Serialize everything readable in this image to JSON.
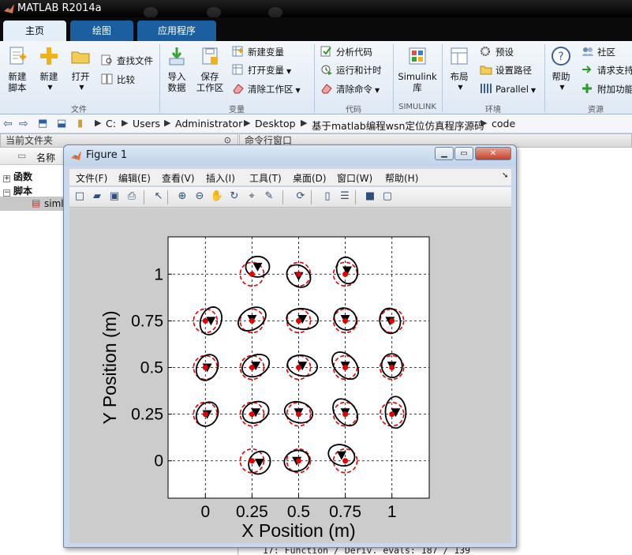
{
  "app": {
    "title": "MATLAB R2014a"
  },
  "tabs": [
    {
      "label": "主页"
    },
    {
      "label": "绘图"
    },
    {
      "label": "应用程序"
    }
  ],
  "ribbon": {
    "file": {
      "new_script": "新建\n脚本",
      "new": "新建",
      "open": "打开",
      "find_files": "查找文件",
      "compare": "比较",
      "group": "文件"
    },
    "variable": {
      "import": "导入\n数据",
      "save_ws": "保存\n工作区",
      "new_var": "新建变量",
      "open_var": "打开变量",
      "clear_ws": "清除工作区",
      "group": "变量"
    },
    "code": {
      "analyze": "分析代码",
      "run_time": "运行和计时",
      "clear_cmd": "清除命令",
      "group": "代码"
    },
    "simulink": {
      "label": "Simulink\n库",
      "group": "SIMULINK"
    },
    "env": {
      "layout": "布局",
      "prefs": "预设",
      "set_path": "设置路径",
      "parallel": "Parallel",
      "group": "环境"
    },
    "resources": {
      "help": "帮助",
      "community": "社区",
      "support": "请求支持",
      "addons": "附加功能",
      "group": "资源"
    }
  },
  "address": {
    "crumbs": [
      "C:",
      "Users",
      "Administrator",
      "Desktop",
      "基于matlab编程wsn定位仿真程序源码",
      "code"
    ]
  },
  "panels": {
    "current_folder": "当前文件夹",
    "command_window": "命令行窗口",
    "name_col": "名称",
    "tree": [
      {
        "label": "函数",
        "toggle": "+"
      },
      {
        "label": "脚本",
        "toggle": "−"
      }
    ],
    "file_item": "siml",
    "cmd_last_line": "17: Function / Deriv. evals: 187 / 139"
  },
  "figure": {
    "title": "Figure 1",
    "menus": [
      "文件(F)",
      "编辑(E)",
      "查看(V)",
      "插入(I)",
      "工具(T)",
      "桌面(D)",
      "窗口(W)",
      "帮助(H)"
    ],
    "toolbar_icons": [
      "new-figure-icon",
      "open-file-icon",
      "save-icon",
      "print-icon",
      "pointer-icon",
      "zoom-in-icon",
      "zoom-out-icon",
      "pan-icon",
      "rotate-icon",
      "data-cursor-icon",
      "brush-icon",
      "link-icon",
      "colorbar-icon",
      "legend-icon",
      "hide-tools-icon",
      "show-tools-icon"
    ]
  },
  "chart_data": {
    "type": "scatter",
    "title": "",
    "xlabel": "X Position (m)",
    "ylabel": "Y Position (m)",
    "xlim": [
      -0.2,
      1.2
    ],
    "ylim": [
      -0.2,
      1.2
    ],
    "xticks": [
      "0",
      "0.25",
      "0.5",
      "0.75",
      "1"
    ],
    "yticks": [
      "0",
      "0.25",
      "0.5",
      "0.75",
      "1"
    ],
    "xtick_values": [
      0,
      0.25,
      0.5,
      0.75,
      1
    ],
    "ytick_values": [
      0,
      0.25,
      0.5,
      0.75,
      1
    ],
    "grid": true,
    "colors": {
      "true": "#e00000",
      "estimate": "#000000"
    },
    "true_positions": [
      [
        0.25,
        1
      ],
      [
        0.5,
        1
      ],
      [
        0.75,
        1
      ],
      [
        0,
        0.75
      ],
      [
        0.25,
        0.75
      ],
      [
        0.5,
        0.75
      ],
      [
        0.75,
        0.75
      ],
      [
        1,
        0.75
      ],
      [
        0,
        0.5
      ],
      [
        0.25,
        0.5
      ],
      [
        0.5,
        0.5
      ],
      [
        0.75,
        0.5
      ],
      [
        1,
        0.5
      ],
      [
        0,
        0.25
      ],
      [
        0.25,
        0.25
      ],
      [
        0.5,
        0.25
      ],
      [
        0.75,
        0.25
      ],
      [
        1,
        0.25
      ],
      [
        0.25,
        0
      ],
      [
        0.5,
        0
      ],
      [
        0.75,
        0
      ]
    ],
    "estimates": [
      [
        0.28,
        1.04
      ],
      [
        0.5,
        0.99
      ],
      [
        0.76,
        1.02
      ],
      [
        0.03,
        0.75
      ],
      [
        0.25,
        0.76
      ],
      [
        0.52,
        0.76
      ],
      [
        0.75,
        0.76
      ],
      [
        0.99,
        0.75
      ],
      [
        0.01,
        0.5
      ],
      [
        0.27,
        0.51
      ],
      [
        0.52,
        0.51
      ],
      [
        0.75,
        0.51
      ],
      [
        1,
        0.51
      ],
      [
        0.01,
        0.25
      ],
      [
        0.27,
        0.26
      ],
      [
        0.5,
        0.26
      ],
      [
        0.75,
        0.26
      ],
      [
        1.02,
        0.26
      ],
      [
        0.29,
        -0.01
      ],
      [
        0.49,
        0.0
      ],
      [
        0.73,
        0.03
      ]
    ]
  }
}
